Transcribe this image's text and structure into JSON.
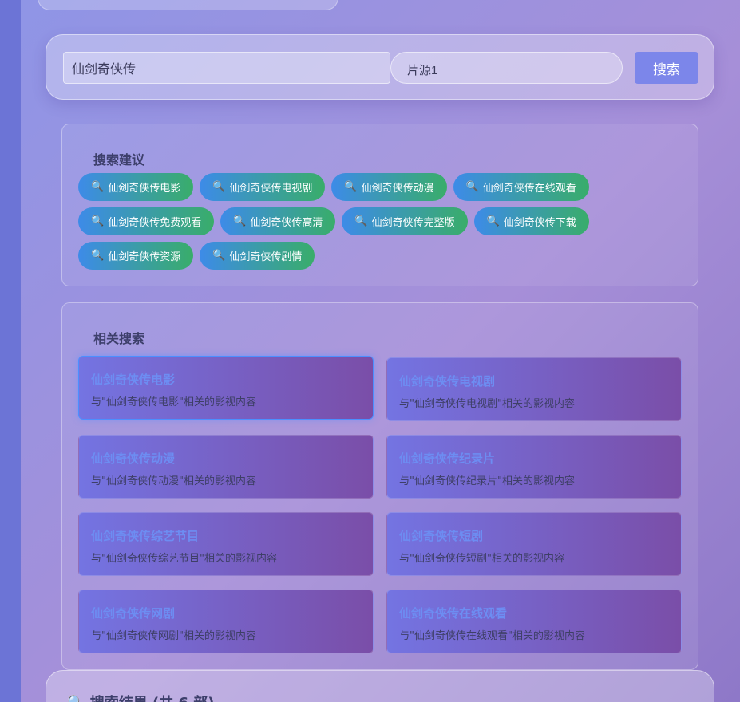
{
  "search": {
    "query": "仙剑奇侠传",
    "source_select_value": "片源1",
    "button_label": "搜索"
  },
  "suggestions": {
    "title": "搜索建议",
    "icon": "magnifier-icon",
    "items": [
      "仙剑奇侠传电影",
      "仙剑奇侠传电视剧",
      "仙剑奇侠传动漫",
      "仙剑奇侠传在线观看",
      "仙剑奇侠传免费观看",
      "仙剑奇侠传高清",
      "仙剑奇侠传完整版",
      "仙剑奇侠传下载",
      "仙剑奇侠传资源",
      "仙剑奇侠传剧情"
    ]
  },
  "related": {
    "title": "相关搜索",
    "items": [
      {
        "title": "仙剑奇侠传电影",
        "desc": "与\"仙剑奇侠传电影\"相关的影视内容"
      },
      {
        "title": "仙剑奇侠传电视剧",
        "desc": "与\"仙剑奇侠传电视剧\"相关的影视内容"
      },
      {
        "title": "仙剑奇侠传动漫",
        "desc": "与\"仙剑奇侠传动漫\"相关的影视内容"
      },
      {
        "title": "仙剑奇侠传纪录片",
        "desc": "与\"仙剑奇侠传纪录片\"相关的影视内容"
      },
      {
        "title": "仙剑奇侠传综艺节目",
        "desc": "与\"仙剑奇侠传综艺节目\"相关的影视内容"
      },
      {
        "title": "仙剑奇侠传短剧",
        "desc": "与\"仙剑奇侠传短剧\"相关的影视内容"
      },
      {
        "title": "仙剑奇侠传网剧",
        "desc": "与\"仙剑奇侠传网剧\"相关的影视内容"
      },
      {
        "title": "仙剑奇侠传在线观看",
        "desc": "与\"仙剑奇侠传在线观看\"相关的影视内容"
      }
    ]
  },
  "results": {
    "icon": "magnifier-icon",
    "title": "搜索结果 (共 6 部)"
  }
}
